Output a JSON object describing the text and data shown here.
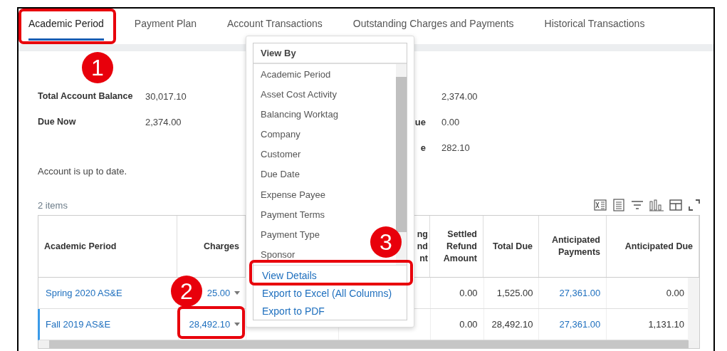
{
  "tabs": [
    {
      "label": "Academic Period",
      "selected": true
    },
    {
      "label": "Payment Plan",
      "selected": false
    },
    {
      "label": "Account Transactions",
      "selected": false
    },
    {
      "label": "Outstanding Charges and Payments",
      "selected": false
    },
    {
      "label": "Historical Transactions",
      "selected": false
    }
  ],
  "summary_left": [
    {
      "label": "Total Account Balance",
      "value": "30,017.10"
    },
    {
      "label": "Due Now",
      "value": "2,374.00"
    }
  ],
  "summary_right": [
    {
      "value": "2,374.00"
    },
    {
      "label": "ue",
      "value": "0.00"
    },
    {
      "label": "e",
      "value": "282.10"
    }
  ],
  "status": "Account is up to date.",
  "item_count": "2 items",
  "table": {
    "columns": [
      {
        "lines": [
          "Academic Period"
        ]
      },
      {
        "lines": [
          "Charges"
        ]
      },
      {
        "lines": [
          "ng",
          "nd",
          "nt"
        ]
      },
      {
        "lines": [
          "Settled",
          "Refund",
          "Amount"
        ]
      },
      {
        "lines": [
          "Total Due"
        ]
      },
      {
        "lines": [
          "Anticipated",
          "Payments"
        ]
      },
      {
        "lines": [
          "Anticipated Due"
        ]
      }
    ],
    "rows": [
      {
        "selected": false,
        "period": "Spring 2020 AS&E",
        "charges": "25.00",
        "settled": "0.00",
        "total_due": "1,525.00",
        "anticipated_payments": "27,361.00",
        "anticipated_due": "0.00"
      },
      {
        "selected": true,
        "period": "Fall 2019 AS&E",
        "charges": "28,492.10",
        "settled": "0.00",
        "total_due": "28,492.10",
        "anticipated_payments": "27,361.00",
        "anticipated_due": "1,131.10"
      }
    ]
  },
  "menu": {
    "header": "View By",
    "items": [
      "Academic Period",
      "Asset Cost Activity",
      "Balancing Worktag",
      "Company",
      "Customer",
      "Due Date",
      "Expense Payee",
      "Payment Terms",
      "Payment Type",
      "Sponsor"
    ],
    "actions": [
      "View Details",
      "Export to Excel (All Columns)",
      "Export to PDF"
    ]
  },
  "annotations": [
    {
      "number": "1"
    },
    {
      "number": "2"
    },
    {
      "number": "3"
    }
  ]
}
